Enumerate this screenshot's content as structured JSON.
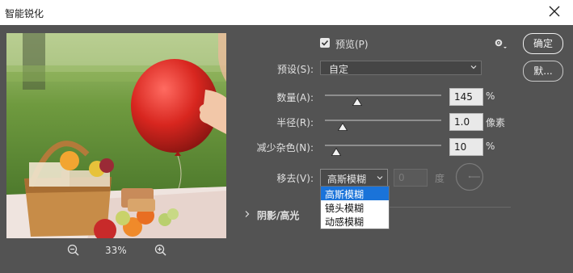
{
  "window": {
    "title": "智能锐化"
  },
  "preview_checkbox": {
    "label": "预览(P)",
    "checked": true
  },
  "preset": {
    "label": "预设(S):",
    "value": "自定"
  },
  "amount": {
    "label": "数量(A):",
    "value": "145",
    "unit": "%",
    "fraction": 0.28
  },
  "radius": {
    "label": "半径(R):",
    "value": "1.0",
    "unit": "像素",
    "fraction": 0.15
  },
  "noise": {
    "label": "减少杂色(N):",
    "value": "10",
    "unit": "%",
    "fraction": 0.1
  },
  "remove": {
    "label": "移去(V):",
    "value": "高斯模糊",
    "angle_value": "0",
    "angle_unit": "度",
    "options": [
      "高斯模糊",
      "镜头模糊",
      "动感模糊"
    ],
    "selected_index": 0
  },
  "shadows_section": {
    "label": "阴影/高光"
  },
  "buttons": {
    "ok": "确定",
    "default": "默..."
  },
  "zoom": {
    "level": "33%"
  },
  "icons": {
    "gear": "gear-icon",
    "close": "close-icon",
    "zoom_in": "zoom-in-icon",
    "zoom_out": "zoom-out-icon"
  },
  "colors": {
    "background": "#535353",
    "accent": "#1a73d9"
  }
}
